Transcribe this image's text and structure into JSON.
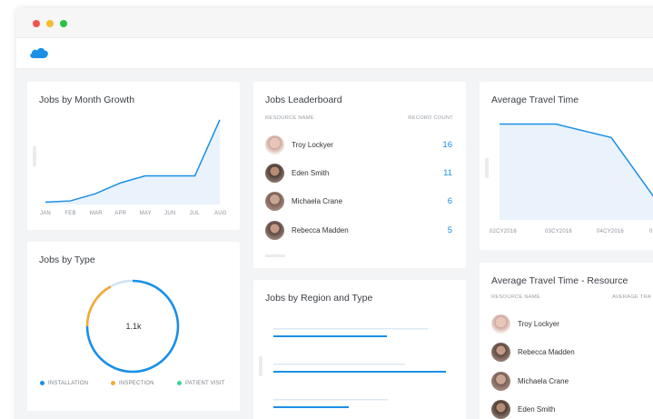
{
  "window": {
    "traffic_lights": [
      "close",
      "minimize",
      "zoom"
    ]
  },
  "app": {
    "logo_icon": "cloud-logo-icon",
    "brand_color": "#1a8fe6"
  },
  "jobs_by_month": {
    "title": "Jobs by Month Growth",
    "months": [
      "JAN",
      "FEB",
      "MAR",
      "APR",
      "MAY",
      "JUN",
      "JUL",
      "AUG"
    ]
  },
  "jobs_by_type": {
    "title": "Jobs by Type",
    "total": "1.1k",
    "legend": [
      {
        "label": "INSTALLATION",
        "color": "#1a8fe6"
      },
      {
        "label": "INSPECTION",
        "color": "#f2a93b"
      },
      {
        "label": "PATIENT VISIT",
        "color": "#3dd39b"
      }
    ]
  },
  "leaderboard": {
    "title": "Jobs Leaderboard",
    "col_resource": "RESOURCE NAME",
    "col_count": "RECORD COUNT",
    "rows": [
      {
        "name": "Troy Lockyer",
        "count": "16"
      },
      {
        "name": "Eden Smith",
        "count": "11"
      },
      {
        "name": "Michaela Crane",
        "count": "6"
      },
      {
        "name": "Rebecca Madden",
        "count": "5"
      }
    ]
  },
  "region": {
    "title": "Jobs by Region and Type"
  },
  "travel": {
    "title": "Average Travel Time",
    "ticks": [
      "02CY2016",
      "03CY2016",
      "04CY2016",
      "0"
    ]
  },
  "travel_resource": {
    "title": "Average Travel Time - Resource",
    "col_resource": "RESOURCE NAME",
    "col_avg": "AVERAGE TRA",
    "rows": [
      {
        "name": "Troy Lockyer"
      },
      {
        "name": "Rebecca Madden"
      },
      {
        "name": "Michaela Crane"
      },
      {
        "name": "Eden Smith"
      }
    ]
  },
  "chart_data": [
    {
      "type": "area",
      "title": "Jobs by Month Growth",
      "categories": [
        "JAN",
        "FEB",
        "MAR",
        "APR",
        "MAY",
        "JUN",
        "JUL",
        "AUG"
      ],
      "values": [
        2,
        3,
        9,
        18,
        24,
        24,
        24,
        71
      ],
      "ylim": [
        0,
        80
      ],
      "grid": false
    },
    {
      "type": "pie",
      "title": "Jobs by Type",
      "categories": [
        "INSTALLATION",
        "INSPECTION",
        "PATIENT VISIT"
      ],
      "values": [
        75,
        17,
        8
      ],
      "colors": [
        "#1a8fe6",
        "#f2a93b",
        "#cfe3f5"
      ]
    },
    {
      "type": "bar",
      "title": "Jobs by Region and Type",
      "series": [
        {
          "values": [
            170,
            145,
            126
          ]
        },
        {
          "values": [
            125,
            190,
            83
          ]
        }
      ]
    },
    {
      "type": "area",
      "title": "Average Travel Time",
      "categories": [
        "02CY2016",
        "03CY2016",
        "04CY2016"
      ],
      "values": [
        100,
        100,
        86,
        20
      ],
      "ylim": [
        0,
        110
      ]
    }
  ]
}
